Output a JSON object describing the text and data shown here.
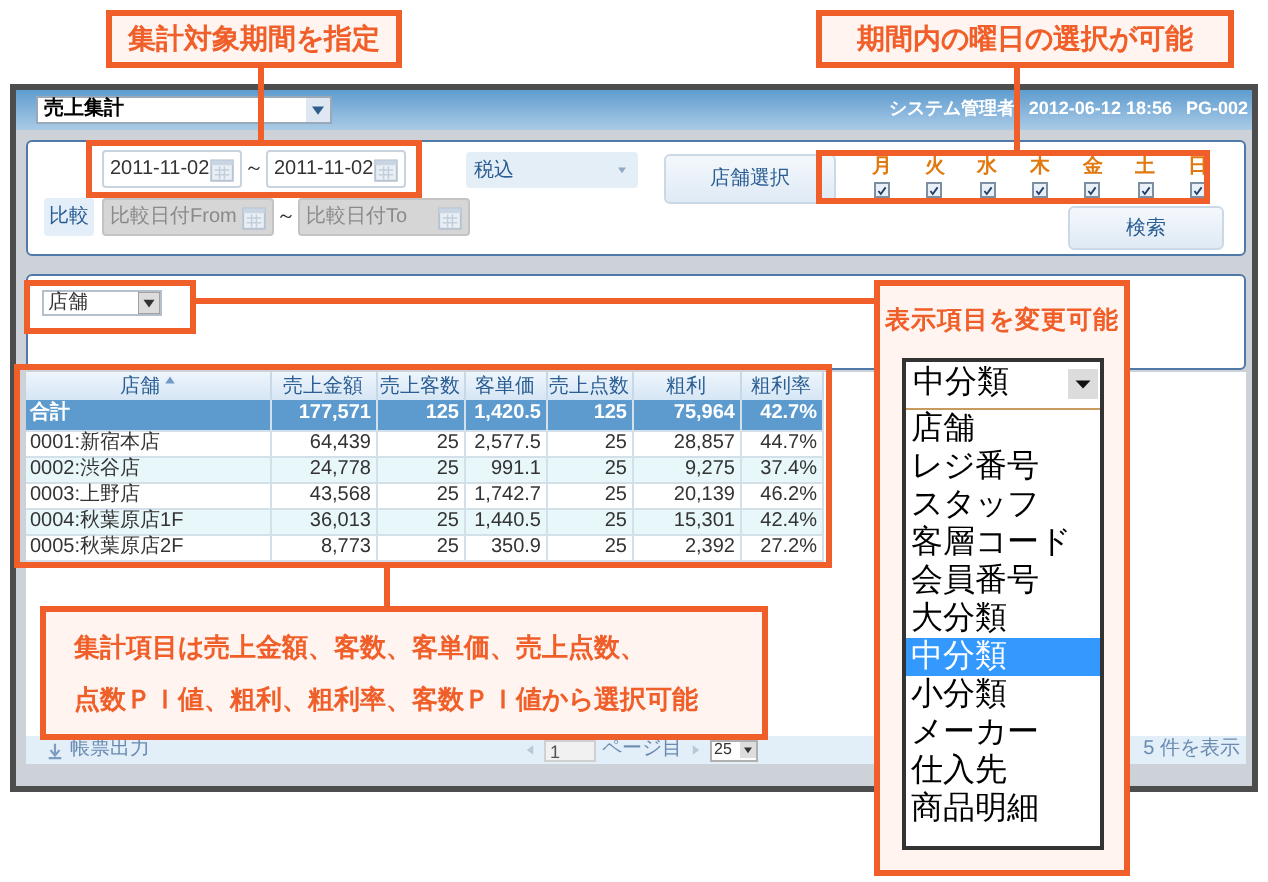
{
  "callouts": {
    "period": {
      "text": "集計対象期間を指定"
    },
    "weekdays": {
      "text": "期間内の曜日の選択が可能"
    }
  },
  "app": {
    "screen_select": "売上集計",
    "user": "システム管理者",
    "datetime": "2012-06-12 18:56",
    "screen_id": "PG-002"
  },
  "filters": {
    "date_from": "2011-11-02",
    "date_separator": "～",
    "date_to": "2011-11-02",
    "tax_select": "税込",
    "store_button": "店舗選択",
    "weekdays": [
      {
        "label": "月",
        "checked": true
      },
      {
        "label": "火",
        "checked": true
      },
      {
        "label": "水",
        "checked": true
      },
      {
        "label": "木",
        "checked": true
      },
      {
        "label": "金",
        "checked": true
      },
      {
        "label": "土",
        "checked": true
      },
      {
        "label": "日",
        "checked": true
      }
    ],
    "compare_button": "比較",
    "compare_from": {
      "placeholder": "比較日付From",
      "disabled": true
    },
    "compare_separator": "～",
    "compare_to": {
      "placeholder": "比較日付To",
      "disabled": true
    },
    "search_button": "検索"
  },
  "display_select": "店舗",
  "display_callout": {
    "text": "表示項目を変更可能",
    "select_value": "中分類",
    "options": [
      {
        "label": "店舗",
        "selected": false
      },
      {
        "label": "レジ番号",
        "selected": false
      },
      {
        "label": "スタッフ",
        "selected": false
      },
      {
        "label": "客層コード",
        "selected": false
      },
      {
        "label": "会員番号",
        "selected": false
      },
      {
        "label": "大分類",
        "selected": false
      },
      {
        "label": "中分類",
        "selected": true
      },
      {
        "label": "小分類",
        "selected": false
      },
      {
        "label": "メーカー",
        "selected": false
      },
      {
        "label": "仕入先",
        "selected": false
      },
      {
        "label": "商品明細",
        "selected": false
      }
    ]
  },
  "table": {
    "columns": [
      {
        "label": "店舗",
        "sorted": true
      },
      {
        "label": "売上金額",
        "sorted": false
      },
      {
        "label": "売上客数",
        "sorted": false
      },
      {
        "label": "客単価",
        "sorted": false
      },
      {
        "label": "売上点数",
        "sorted": false
      },
      {
        "label": "粗利",
        "sorted": false
      },
      {
        "label": "粗利率",
        "sorted": false
      }
    ],
    "total_row": [
      "合計",
      "177,571",
      "125",
      "1,420.5",
      "125",
      "75,964",
      "42.7%"
    ],
    "rows": [
      [
        "0001:新宿本店",
        "64,439",
        "25",
        "2,577.5",
        "25",
        "28,857",
        "44.7%"
      ],
      [
        "0002:渋谷店",
        "24,778",
        "25",
        "991.1",
        "25",
        "9,275",
        "37.4%"
      ],
      [
        "0003:上野店",
        "43,568",
        "25",
        "1,742.7",
        "25",
        "20,139",
        "46.2%"
      ],
      [
        "0004:秋葉原店1F",
        "36,013",
        "25",
        "1,440.5",
        "25",
        "15,301",
        "42.4%"
      ],
      [
        "0005:秋葉原店2F",
        "8,773",
        "25",
        "350.9",
        "25",
        "2,392",
        "27.2%"
      ]
    ]
  },
  "items_callout": {
    "lines": [
      "集計項目は売上金額、客数、客単価、売上点数、",
      "点数ＰＩ値、粗利、粗利率、客数ＰＩ値から選択可能"
    ]
  },
  "footer": {
    "export": "帳票出力",
    "page": "1",
    "page_label": "ページ目",
    "page_size": "25",
    "count": "5 件を表示"
  }
}
